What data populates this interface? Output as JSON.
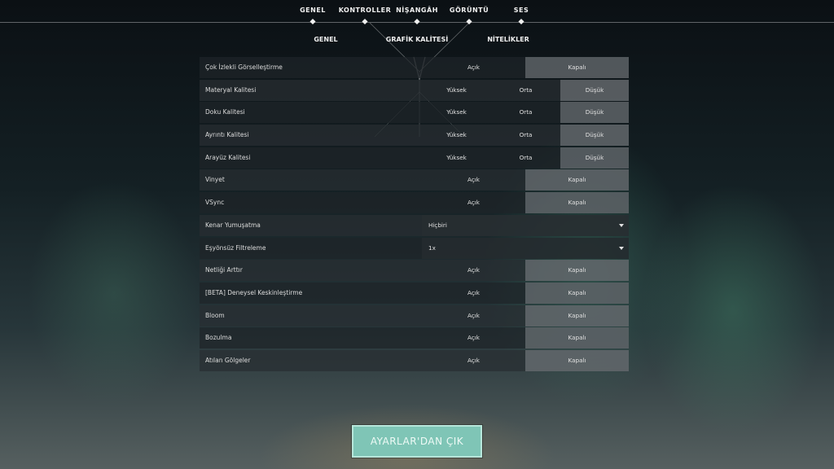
{
  "top_tabs": [
    "GENEL",
    "KONTROLLER",
    "NİŞANGÂH",
    "GÖRÜNTÜ",
    "SES"
  ],
  "sub_tabs": [
    "GENEL",
    "GRAFİK KALİTESİ",
    "NİTELİKLER"
  ],
  "rows": [
    {
      "label": "Çok İzlekli Görselleştirme",
      "options": [
        "Açık",
        "Kapalı"
      ],
      "selected": "Kapalı"
    },
    {
      "label": "Materyal Kalitesi",
      "options": [
        "Yüksek",
        "Orta",
        "Düşük"
      ],
      "selected": "Düşük"
    },
    {
      "label": "Doku Kalitesi",
      "options": [
        "Yüksek",
        "Orta",
        "Düşük"
      ],
      "selected": "Düşük"
    },
    {
      "label": "Ayrıntı Kalitesi",
      "options": [
        "Yüksek",
        "Orta",
        "Düşük"
      ],
      "selected": "Düşük"
    },
    {
      "label": "Arayüz Kalitesi",
      "options": [
        "Yüksek",
        "Orta",
        "Düşük"
      ],
      "selected": "Düşük"
    },
    {
      "label": "Vinyet",
      "options": [
        "Açık",
        "Kapalı"
      ],
      "selected": "Kapalı"
    },
    {
      "label": "VSync",
      "options": [
        "Açık",
        "Kapalı"
      ],
      "selected": "Kapalı"
    },
    {
      "label": "Kenar Yumuşatma",
      "dropdown": "Hiçbiri"
    },
    {
      "label": "Eşyönsüz Filtreleme",
      "dropdown": "1x"
    },
    {
      "label": "Netliği Arttır",
      "options": [
        "Açık",
        "Kapalı"
      ],
      "selected": "Kapalı"
    },
    {
      "label": "[BETA] Deneysel Keskinleştirme",
      "options": [
        "Açık",
        "Kapalı"
      ],
      "selected": "Kapalı"
    },
    {
      "label": "Bloom",
      "options": [
        "Açık",
        "Kapalı"
      ],
      "selected": "Kapalı"
    },
    {
      "label": "Bozulma",
      "options": [
        "Açık",
        "Kapalı"
      ],
      "selected": "Kapalı"
    },
    {
      "label": "Atılan Gölgeler",
      "options": [
        "Açık",
        "Kapalı"
      ],
      "selected": "Kapalı"
    }
  ],
  "exit_button": "AYARLAR'DAN ÇIK",
  "colors": {
    "accent": "#7fc5b6",
    "selected_option": "#5d6266"
  }
}
